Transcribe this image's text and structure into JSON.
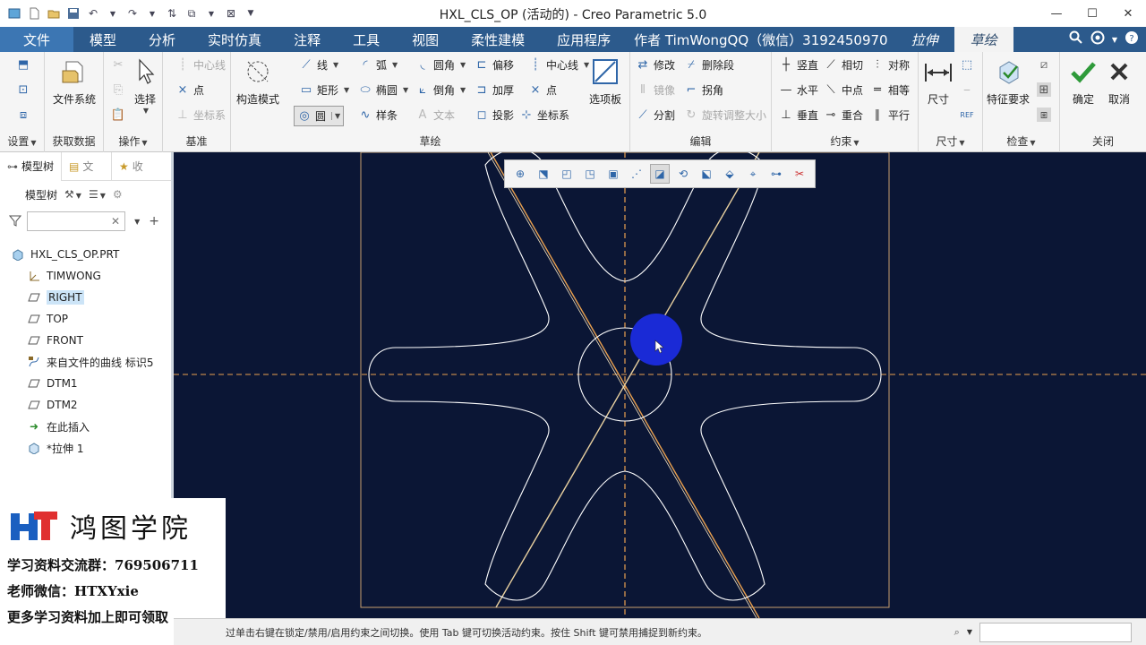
{
  "window": {
    "title": "HXL_CLS_OP (活动的) - Creo Parametric 5.0",
    "minimize": "—",
    "maximize": "☐",
    "close": "✕"
  },
  "menu": {
    "tabs": [
      "文件",
      "模型",
      "分析",
      "实时仿真",
      "注释",
      "工具",
      "视图",
      "柔性建模",
      "应用程序"
    ],
    "author": "作者 TimWongQQ（微信）3192450970",
    "extrude_tab": "拉伸",
    "sketch_tab": "草绘"
  },
  "ribbon": {
    "setup": {
      "label": "设置"
    },
    "get_data": {
      "file_system": "文件系统",
      "label": "获取数据"
    },
    "operations": {
      "select": "选择",
      "label": "操作"
    },
    "datum": {
      "centerline": "中心线",
      "point": "点",
      "csys": "坐标系",
      "label": "基准"
    },
    "sketch": {
      "construction_mode": "构造模式",
      "line": "线",
      "arc": "弧",
      "fillet": "圆角",
      "offset": "偏移",
      "centerline": "中心线",
      "rectangle": "矩形",
      "ellipse": "椭圆",
      "chamfer": "倒角",
      "thicken": "加厚",
      "point": "点",
      "circle": "圆",
      "spline": "样条",
      "text": "文本",
      "project": "投影",
      "csys": "坐标系",
      "palette": "选项板",
      "label": "草绘"
    },
    "edit": {
      "modify": "修改",
      "delete_segment": "删除段",
      "mirror": "镜像",
      "corner": "拐角",
      "divide": "分割",
      "rotate_resize": "旋转调整大小",
      "label": "编辑"
    },
    "constrain": {
      "vertical": "竖直",
      "tangent": "相切",
      "symmetric": "对称",
      "horizontal": "水平",
      "midpoint": "中点",
      "equal": "相等",
      "perpendicular": "垂直",
      "coincident": "重合",
      "parallel": "平行",
      "label": "约束"
    },
    "dimension": {
      "dimension": "尺寸",
      "label": "尺寸"
    },
    "inspect": {
      "feature_requirements": "特征要求",
      "label": "检查"
    },
    "close": {
      "ok": "确定",
      "cancel": "取消",
      "label": "关闭"
    }
  },
  "left_panel": {
    "tabs": [
      "模型树",
      "文",
      "收"
    ],
    "toolbar_label": "模型树",
    "filter_placeholder": "",
    "tree": [
      {
        "label": "HXL_CLS_OP.PRT",
        "icon": "part-icon"
      },
      {
        "label": "TIMWONG",
        "icon": "csys-icon"
      },
      {
        "label": "RIGHT",
        "icon": "plane-icon",
        "selected": true
      },
      {
        "label": "TOP",
        "icon": "plane-icon"
      },
      {
        "label": "FRONT",
        "icon": "plane-icon"
      },
      {
        "label": "来自文件的曲线 标识5",
        "icon": "curve-icon"
      },
      {
        "label": "DTM1",
        "icon": "plane-icon"
      },
      {
        "label": "DTM2",
        "icon": "plane-icon"
      },
      {
        "label": "在此插入",
        "icon": "insert-arrow-icon"
      },
      {
        "label": "*拉伸 1",
        "icon": "extrude-icon"
      }
    ]
  },
  "watermark": {
    "name": "鸿图学院",
    "line1": "学习资料交流群：769506711",
    "line2": "老师微信：HTXYxie",
    "line3": "更多学习资料加上即可领取"
  },
  "status": {
    "message": "过单击右键在锁定/禁用/启用约束之间切换。使用 Tab 键可切换活动约束。按住 Shift 键可禁用捕捉到新约束。"
  },
  "colors": {
    "menubar": "#2c5a8c",
    "canvas": "#0b1635",
    "centerline": "#e8a050",
    "sketch": "#ffffff",
    "cursor_highlight": "#1a2ad6"
  }
}
